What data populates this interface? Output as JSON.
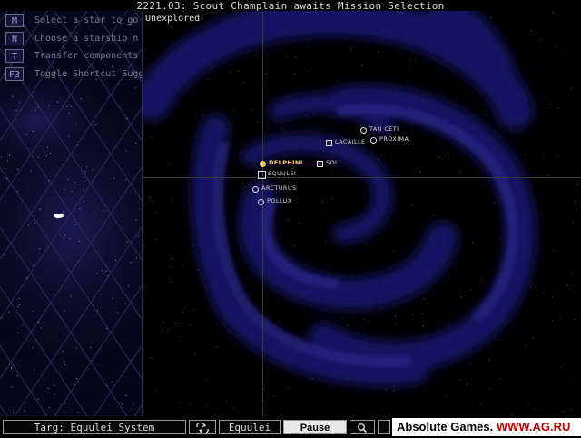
{
  "header": {
    "title": "2221.03: Scout Champlain awaits Mission Selection"
  },
  "shortcuts": [
    {
      "key": "M",
      "text": "Select a star to go"
    },
    {
      "key": "N",
      "text": "Choose a starship n"
    },
    {
      "key": "T",
      "text": "Transfer components"
    },
    {
      "key": "F3",
      "text": "Toggle Shortcut Sugg"
    }
  ],
  "map": {
    "region_label": "Unexplored",
    "stars": [
      {
        "name": "TAU CETI",
        "style": "circle"
      },
      {
        "name": "LACAILLE",
        "style": "square"
      },
      {
        "name": "PROXIMA",
        "style": "circle"
      },
      {
        "name": "DELPHINI",
        "style": "selected"
      },
      {
        "name": "SOL",
        "style": "square"
      },
      {
        "name": "EQUULEI",
        "style": "boxed"
      },
      {
        "name": "ARCTURUS",
        "style": "circle"
      },
      {
        "name": "POLLUX",
        "style": "circle"
      }
    ]
  },
  "bottombar": {
    "target": "Targ: Equulei System",
    "cycle_icon": "cycle-arrows-icon",
    "system": "Equulei",
    "pause": "Pause",
    "search_icon": "magnifier-icon"
  },
  "banner": {
    "brand": "Absolute Games.",
    "url": "WWW.AG.RU"
  },
  "colors": {
    "selected": "#ffd84a",
    "galaxy": "#1a1a6a",
    "grid": "#2a2a5a",
    "url": "#cc0000"
  }
}
